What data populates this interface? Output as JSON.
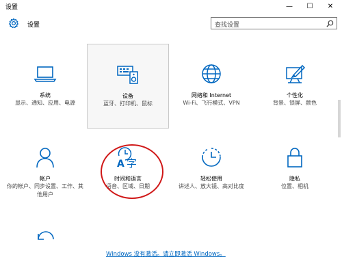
{
  "window": {
    "title": "设置",
    "controls": {
      "minimize": "—",
      "maximize": "☐",
      "close": "✕"
    }
  },
  "header": {
    "title": "设置",
    "search_placeholder": "查找设置"
  },
  "tiles": [
    {
      "name": "系统",
      "desc": "显示、通知、应用、电源",
      "icon": "laptop-icon"
    },
    {
      "name": "设备",
      "desc": "蓝牙、打印机、鼠标",
      "icon": "keyboard-speaker-icon"
    },
    {
      "name": "网络和 Internet",
      "desc": "Wi-Fi、飞行模式、VPN",
      "icon": "globe-icon"
    },
    {
      "name": "个性化",
      "desc": "背景、锁屏、颜色",
      "icon": "paint-icon"
    },
    {
      "name": "帐户",
      "desc": "你的帐户、同步设置、工作、其他用户",
      "icon": "person-icon"
    },
    {
      "name": "时间和语言",
      "desc": "语音、区域、日期",
      "icon": "time-language-icon"
    },
    {
      "name": "轻松使用",
      "desc": "讲述人、放大镜、高对比度",
      "icon": "ease-of-access-icon"
    },
    {
      "name": "隐私",
      "desc": "位置、相机",
      "icon": "lock-icon"
    }
  ],
  "activation": {
    "text": "Windows 没有激活。请立即激活 Windows。"
  },
  "colors": {
    "accent": "#0067c0",
    "highlight_circle": "#d01818"
  }
}
